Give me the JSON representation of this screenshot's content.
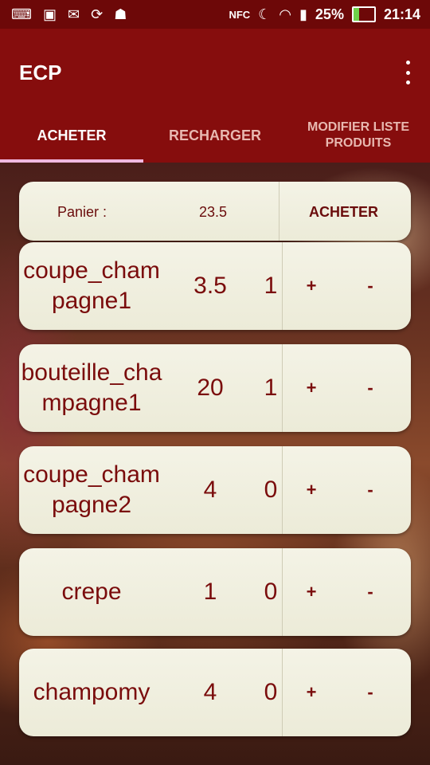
{
  "status_bar": {
    "icons_left": [
      "usb-debug-icon",
      "image-icon",
      "gmail-icon",
      "sync-icon",
      "android-icon"
    ],
    "icons_right": [
      "nfc-icon",
      "do-not-disturb-icon",
      "wifi-icon",
      "signal-icon"
    ],
    "nfc_label": "NFC",
    "battery_pct": "25%",
    "clock": "21:14"
  },
  "app_bar": {
    "title": "ECP"
  },
  "tabs": [
    {
      "label": "ACHETER",
      "active": true
    },
    {
      "label": "RECHARGER",
      "active": false
    },
    {
      "label": "MODIFIER LISTE PRODUITS",
      "active": false
    }
  ],
  "basket": {
    "label": "Panier :",
    "total": "23.5",
    "buy_label": "ACHETER"
  },
  "items": [
    {
      "name": "coupe_champagne1",
      "price": "3.5",
      "qty": "1",
      "plus": "+",
      "minus": "-"
    },
    {
      "name": "bouteille_champagne1",
      "price": "20",
      "qty": "1",
      "plus": "+",
      "minus": "-"
    },
    {
      "name": "coupe_champagne2",
      "price": "4",
      "qty": "0",
      "plus": "+",
      "minus": "-"
    },
    {
      "name": "crepe",
      "price": "1",
      "qty": "0",
      "plus": "+",
      "minus": "-"
    },
    {
      "name": "champomy",
      "price": "4",
      "qty": "0",
      "plus": "+",
      "minus": "-"
    }
  ],
  "colors": {
    "status_bar": "#6d0808",
    "app_bar": "#860d0d",
    "text_accent": "#7a0c0c",
    "card": "#f0efdf",
    "tab_indicator": "#f0b8e0"
  }
}
